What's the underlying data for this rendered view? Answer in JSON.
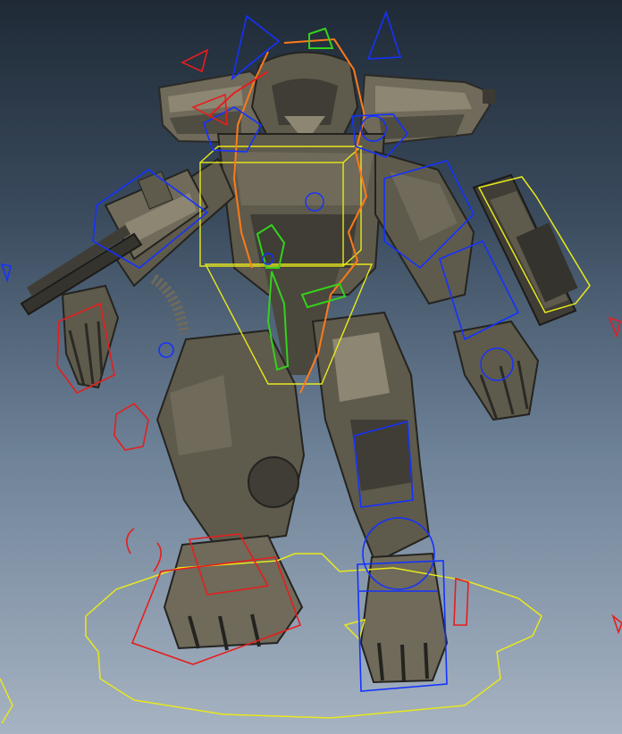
{
  "viewport": {
    "background_top": "#1f2a36",
    "background_bottom": "#a6b3c2"
  },
  "model": {
    "armor_light": "#8c8672",
    "armor_mid": "#5e5a4c",
    "armor_dark": "#34332d"
  },
  "rig_controls": {
    "fk_color": "#1432ff",
    "ik_color": "#e51e1e",
    "root_color": "#e8e81c",
    "spine_color": "#ff7a1a",
    "face_color": "#34d11c"
  },
  "icons": [
    "wire-cube-icon",
    "locator-icon",
    "arrow-control-icon",
    "circle-control-icon"
  ]
}
